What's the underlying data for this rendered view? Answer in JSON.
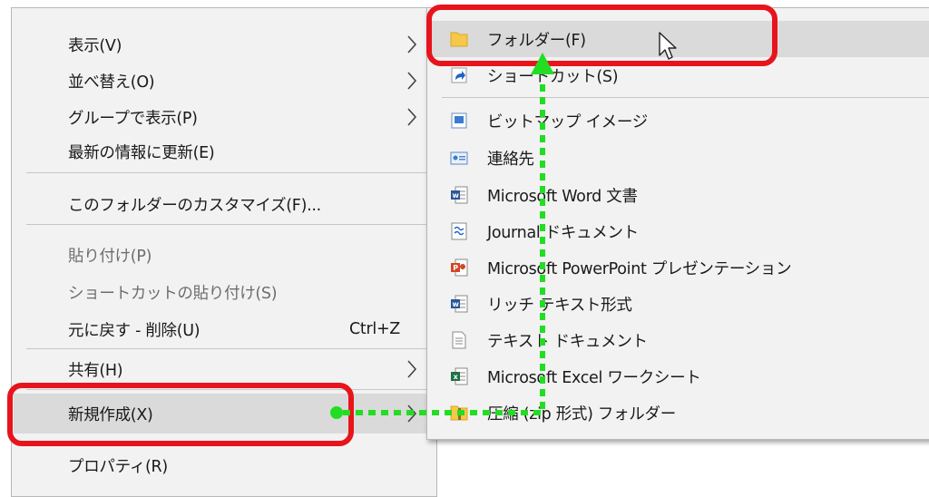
{
  "context_menu": {
    "items": [
      {
        "label": "表示(V)",
        "submenu": true
      },
      {
        "label": "並べ替え(O)",
        "submenu": true
      },
      {
        "label": "グループで表示(P)",
        "submenu": true
      },
      {
        "label": "最新の情報に更新(E)"
      },
      {
        "label": "このフォルダーのカスタマイズ(F)..."
      },
      {
        "label": "貼り付け(P)",
        "disabled": true
      },
      {
        "label": "ショートカットの貼り付け(S)",
        "disabled": true
      },
      {
        "label": "元に戻す - 削除(U)",
        "shortcut": "Ctrl+Z"
      },
      {
        "label": "共有(H)",
        "submenu": true
      },
      {
        "label": "新規作成(X)",
        "submenu": true,
        "highlighted": true
      },
      {
        "label": "プロパティ(R)"
      }
    ]
  },
  "submenu_new": {
    "items": [
      {
        "label": "フォルダー(F)",
        "icon": "folder-icon",
        "highlighted": true
      },
      {
        "label": "ショートカット(S)",
        "icon": "shortcut-icon"
      },
      {
        "label": "ビットマップ イメージ",
        "icon": "bitmap-icon"
      },
      {
        "label": "連絡先",
        "icon": "contact-icon"
      },
      {
        "label": "Microsoft Word 文書",
        "icon": "word-icon"
      },
      {
        "label": "Journal ドキュメント",
        "icon": "journal-icon"
      },
      {
        "label": "Microsoft PowerPoint プレゼンテーション",
        "icon": "powerpoint-icon"
      },
      {
        "label": "リッチ テキスト形式",
        "icon": "rtf-icon"
      },
      {
        "label": "テキスト ドキュメント",
        "icon": "text-document-icon"
      },
      {
        "label": "Microsoft Excel ワークシート",
        "icon": "excel-icon"
      },
      {
        "label": "圧縮 (zip 形式) フォルダー",
        "icon": "zip-folder-icon"
      }
    ]
  },
  "colors": {
    "callout_red": "#e8141c",
    "guide_green": "#22dd22",
    "menu_background": "#f2f2f2",
    "highlight": "#dadada"
  }
}
